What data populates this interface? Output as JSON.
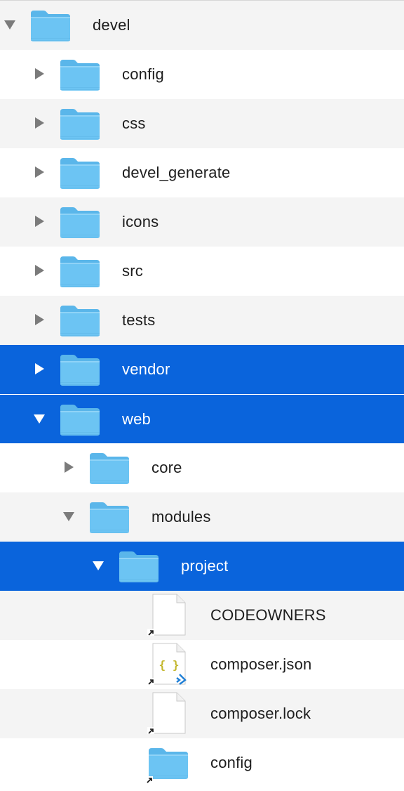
{
  "window": {
    "title": "devel"
  },
  "colors": {
    "selection": "#0a64dc",
    "row_alt": "#f4f4f4",
    "row_base": "#ffffff",
    "folder": "#6cc4f3",
    "disclosure": "#7b7b7b"
  },
  "items": [
    {
      "label": "devel",
      "depth": 0,
      "kind": "folder",
      "icon": "folder-icon",
      "disclosure": "expanded",
      "selected": false
    },
    {
      "label": "config",
      "depth": 1,
      "kind": "folder",
      "icon": "folder-icon",
      "disclosure": "collapsed",
      "selected": false
    },
    {
      "label": "css",
      "depth": 1,
      "kind": "folder",
      "icon": "folder-icon",
      "disclosure": "collapsed",
      "selected": false
    },
    {
      "label": "devel_generate",
      "depth": 1,
      "kind": "folder",
      "icon": "folder-icon",
      "disclosure": "collapsed",
      "selected": false
    },
    {
      "label": "icons",
      "depth": 1,
      "kind": "folder",
      "icon": "folder-icon",
      "disclosure": "collapsed",
      "selected": false
    },
    {
      "label": "src",
      "depth": 1,
      "kind": "folder",
      "icon": "folder-icon",
      "disclosure": "collapsed",
      "selected": false
    },
    {
      "label": "tests",
      "depth": 1,
      "kind": "folder",
      "icon": "folder-icon",
      "disclosure": "collapsed",
      "selected": false
    },
    {
      "label": "vendor",
      "depth": 1,
      "kind": "folder",
      "icon": "folder-icon",
      "disclosure": "collapsed",
      "selected": true
    },
    {
      "label": "web",
      "depth": 1,
      "kind": "folder",
      "icon": "folder-icon",
      "disclosure": "expanded",
      "selected": true
    },
    {
      "label": "core",
      "depth": 2,
      "kind": "folder",
      "icon": "folder-icon",
      "disclosure": "collapsed",
      "selected": false
    },
    {
      "label": "modules",
      "depth": 2,
      "kind": "folder",
      "icon": "folder-icon",
      "disclosure": "expanded",
      "selected": false
    },
    {
      "label": "project",
      "depth": 3,
      "kind": "folder",
      "icon": "folder-icon",
      "disclosure": "expanded",
      "selected": true
    },
    {
      "label": "CODEOWNERS",
      "depth": 4,
      "kind": "file",
      "icon": "document-alias-icon",
      "disclosure": "none",
      "selected": false
    },
    {
      "label": "composer.json",
      "depth": 4,
      "kind": "json",
      "icon": "json-file-alias-icon",
      "disclosure": "none",
      "selected": false
    },
    {
      "label": "composer.lock",
      "depth": 4,
      "kind": "file",
      "icon": "document-alias-icon",
      "disclosure": "none",
      "selected": false
    },
    {
      "label": "config",
      "depth": 4,
      "kind": "folder-alias",
      "icon": "folder-alias-icon",
      "disclosure": "none",
      "selected": false
    }
  ]
}
